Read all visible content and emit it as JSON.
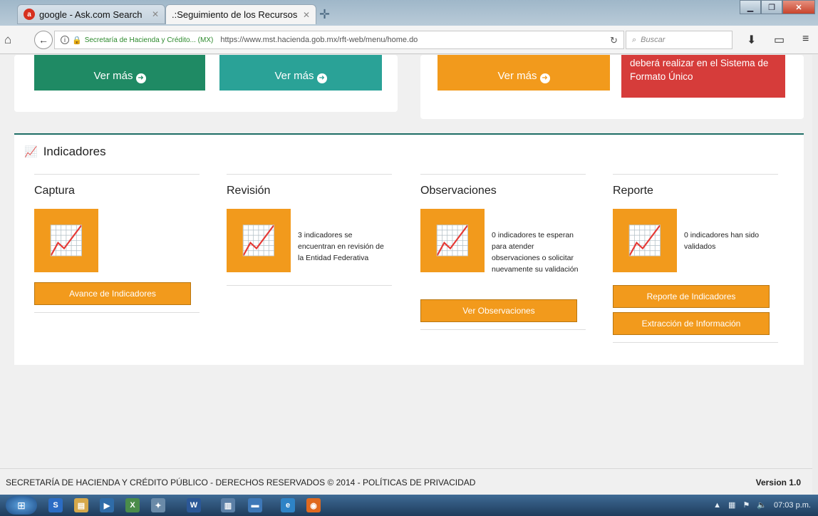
{
  "browser": {
    "tabs": [
      {
        "title": "google - Ask.com Search",
        "favicon": "ask-icon"
      },
      {
        "title": ".:Seguimiento de los Recursos ...",
        "favicon": "page-icon"
      }
    ],
    "site_identity": "Secretaría de Hacienda y Crédito... (MX)",
    "url": "https://www.mst.hacienda.gob.mx/rft-web/menu/home.do",
    "search_placeholder": "Buscar"
  },
  "top_tiles": [
    {
      "label": "Ver más",
      "color": "#1f8a64"
    },
    {
      "label": "Ver más",
      "color": "#2aa297"
    },
    {
      "label": "Ver más",
      "color": "#f29a1c"
    }
  ],
  "red_tile_text": "deberá realizar en el Sistema de Formato Único",
  "indicadores": {
    "heading": "Indicadores",
    "columns": [
      {
        "title": "Captura",
        "desc": "",
        "buttons": [
          "Avance de Indicadores"
        ]
      },
      {
        "title": "Revisión",
        "desc": "3 indicadores se encuentran en revisión de la Entidad Federativa",
        "buttons": []
      },
      {
        "title": "Observaciones",
        "desc": "0 indicadores te esperan para atender observaciones o solicitar nuevamente su validación",
        "buttons": [
          "Ver Observaciones"
        ]
      },
      {
        "title": "Reporte",
        "desc": "0 indicadores han sido validados",
        "buttons": [
          "Reporte de Indicadores",
          "Extracción de Información"
        ]
      }
    ]
  },
  "footer": {
    "text": "SECRETARÍA DE HACIENDA Y CRÉDITO PÚBLICO - DERECHOS RESERVADOS © 2014 - POLÍTICAS DE PRIVACIDAD",
    "version": "Version 1.0"
  },
  "taskbar": {
    "clock": "07:03 p.m."
  },
  "colors": {
    "accent_orange": "#f29a1c",
    "accent_green": "#1f8a64",
    "accent_teal": "#2aa297",
    "accent_red": "#d63c3a"
  }
}
